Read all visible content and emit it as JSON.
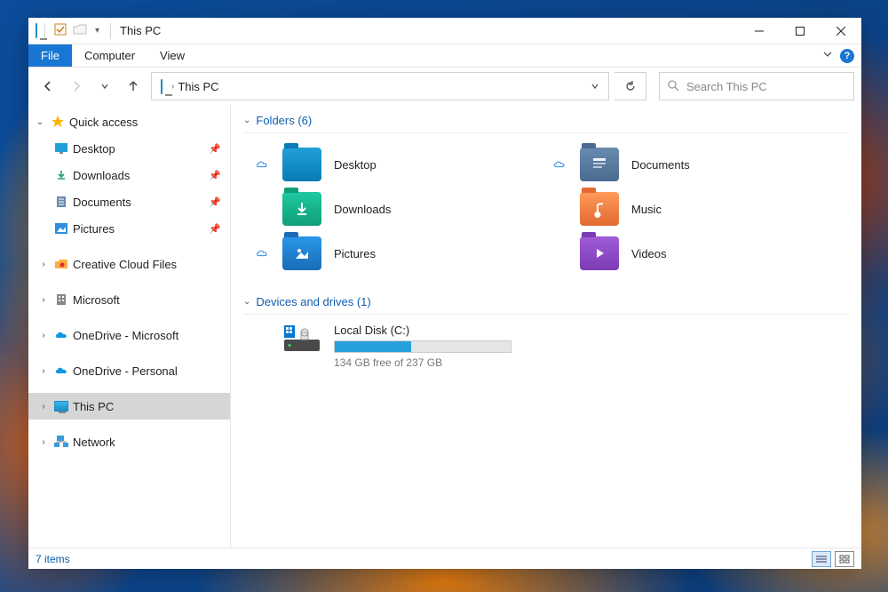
{
  "window": {
    "title": "This PC"
  },
  "ribbon": {
    "tabs": [
      "File",
      "Computer",
      "View"
    ]
  },
  "address": {
    "location": "This PC",
    "refresh_tip": "Refresh"
  },
  "search": {
    "placeholder": "Search This PC"
  },
  "sidebar": {
    "quick_access": "Quick access",
    "quick_items": [
      {
        "label": "Desktop",
        "pinned": true,
        "icon": "desktop"
      },
      {
        "label": "Downloads",
        "pinned": true,
        "icon": "downloads"
      },
      {
        "label": "Documents",
        "pinned": true,
        "icon": "documents"
      },
      {
        "label": "Pictures",
        "pinned": true,
        "icon": "pictures"
      }
    ],
    "tree": [
      {
        "label": "Creative Cloud Files",
        "icon": "cc"
      },
      {
        "label": "Microsoft",
        "icon": "ms"
      },
      {
        "label": "OneDrive - Microsoft",
        "icon": "onedrive"
      },
      {
        "label": "OneDrive - Personal",
        "icon": "onedrive"
      },
      {
        "label": "This PC",
        "icon": "pc",
        "selected": true
      },
      {
        "label": "Network",
        "icon": "network"
      }
    ]
  },
  "content": {
    "folders_header": "Folders (6)",
    "folders": [
      {
        "label": "Desktop",
        "icon": "desktop",
        "cloud": true
      },
      {
        "label": "Documents",
        "icon": "documents",
        "cloud": true
      },
      {
        "label": "Downloads",
        "icon": "downloads",
        "cloud": false
      },
      {
        "label": "Music",
        "icon": "music",
        "cloud": false
      },
      {
        "label": "Pictures",
        "icon": "pictures",
        "cloud": true
      },
      {
        "label": "Videos",
        "icon": "videos",
        "cloud": false
      }
    ],
    "drives_header": "Devices and drives (1)",
    "drive": {
      "label": "Local Disk (C:)",
      "free_text": "134 GB free of 237 GB",
      "used_fraction": 0.435
    }
  },
  "statusbar": {
    "items_text": "7 items"
  }
}
